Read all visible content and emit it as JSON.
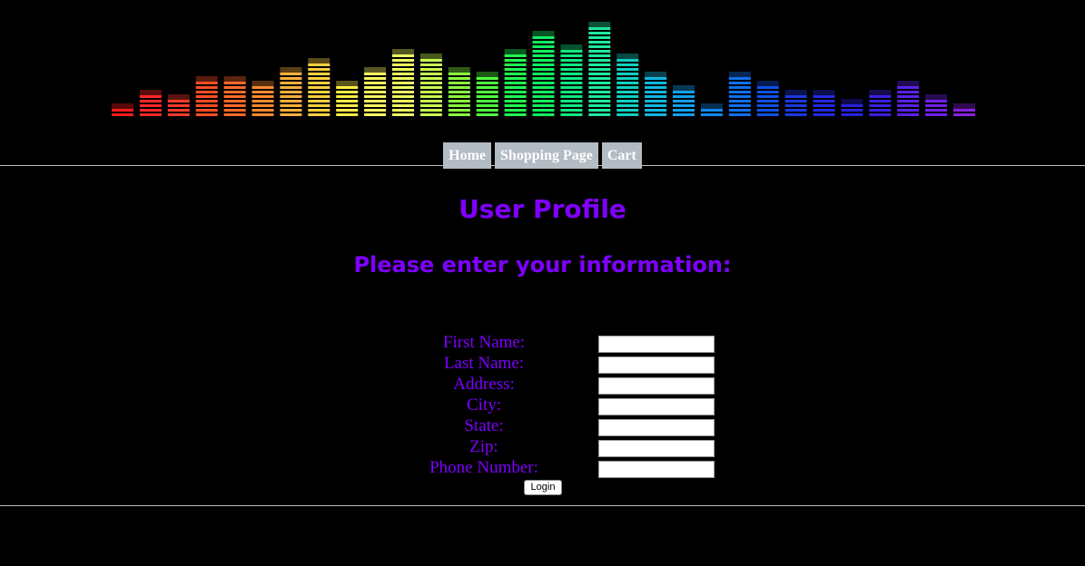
{
  "nav": {
    "items": [
      {
        "label": "Home"
      },
      {
        "label": "Shopping Page"
      },
      {
        "label": "Cart"
      }
    ]
  },
  "header": {
    "title": "User Profile",
    "subtitle": "Please enter your information:"
  },
  "form": {
    "fields": [
      {
        "label": "First Name:",
        "value": ""
      },
      {
        "label": "Last Name:",
        "value": ""
      },
      {
        "label": "Address:",
        "value": ""
      },
      {
        "label": "City:",
        "value": ""
      },
      {
        "label": "State:",
        "value": ""
      },
      {
        "label": "Zip:",
        "value": ""
      },
      {
        "label": "Phone Number:",
        "value": ""
      }
    ],
    "submit_label": "Login"
  },
  "banner": {
    "icon": "equalizer-banner",
    "levels": [
      2,
      5,
      4,
      8,
      8,
      7,
      10,
      12,
      7,
      10,
      14,
      13,
      10,
      9,
      14,
      18,
      15,
      20,
      13,
      9,
      6,
      2,
      9,
      7,
      5,
      5,
      3,
      5,
      7,
      4,
      2
    ],
    "colors": [
      "#ff1a1a",
      "#ff2626",
      "#ff3a2a",
      "#ff4d24",
      "#ff6a2a",
      "#ff8a30",
      "#ffb03a",
      "#ffd040",
      "#ffee48",
      "#fff860",
      "#f0ff60",
      "#c8ff50",
      "#8cff40",
      "#50ff40",
      "#20ff50",
      "#10f060",
      "#10e880",
      "#20e8a0",
      "#10d0c0",
      "#10b8e0",
      "#10a0f0",
      "#1088f0",
      "#1070f0",
      "#1050e8",
      "#1a38e0",
      "#2228e0",
      "#2a20e0",
      "#3a20e0",
      "#5a20e8",
      "#7020e8",
      "#8a20e0"
    ]
  }
}
